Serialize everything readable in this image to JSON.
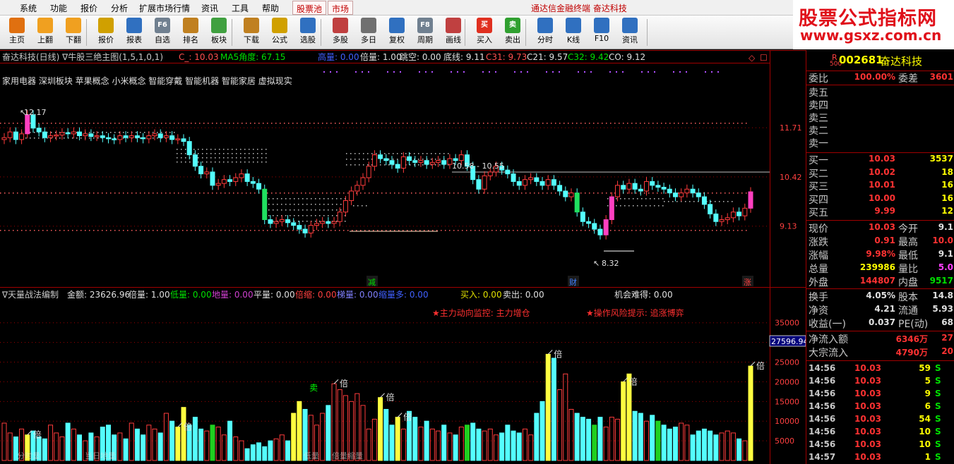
{
  "menu": {
    "items": [
      "系统",
      "功能",
      "报价",
      "分析",
      "扩展市场行情",
      "资讯",
      "工具",
      "帮助"
    ],
    "tabs": [
      "股票池",
      "市场"
    ],
    "brand": "通达信金融终端  奋达科技"
  },
  "toolbar": {
    "buttons": [
      {
        "label": "主页",
        "icon": "home-icon",
        "color": "#e07010"
      },
      {
        "label": "上翻",
        "icon": "arrow-up-icon",
        "color": "#f0a020"
      },
      {
        "label": "下翻",
        "icon": "arrow-down-icon",
        "color": "#f0a020"
      },
      {
        "label": "报价",
        "icon": "quote-icon",
        "color": "#d0a000"
      },
      {
        "label": "报表",
        "icon": "report-icon",
        "color": "#3070c0"
      },
      {
        "label": "自选",
        "icon": "f6-icon",
        "color": "#708090"
      },
      {
        "label": "排名",
        "icon": "rank-icon",
        "color": "#c08020"
      },
      {
        "label": "板块",
        "icon": "sector-icon",
        "color": "#40a040"
      },
      {
        "label": "下载",
        "icon": "download-icon",
        "color": "#c08020"
      },
      {
        "label": "公式",
        "icon": "formula-icon",
        "color": "#d0a000"
      },
      {
        "label": "选股",
        "icon": "stock-pick-icon",
        "color": "#3070c0"
      },
      {
        "label": "多股",
        "icon": "multi-stock-icon",
        "color": "#c04040"
      },
      {
        "label": "多日",
        "icon": "clock-icon",
        "color": "#707070"
      },
      {
        "label": "复权",
        "icon": "adjust-icon",
        "color": "#3070c0"
      },
      {
        "label": "周期",
        "icon": "f8-icon",
        "color": "#708090"
      },
      {
        "label": "画线",
        "icon": "draw-line-icon",
        "color": "#c04040"
      },
      {
        "label": "买入",
        "icon": "buy-icon",
        "color": "#e03020"
      },
      {
        "label": "卖出",
        "icon": "sell-icon",
        "color": "#30a030"
      },
      {
        "label": "分时",
        "icon": "intraday-icon",
        "color": "#3070c0"
      },
      {
        "label": "K线",
        "icon": "kline-icon",
        "color": "#3070c0"
      },
      {
        "label": "F10",
        "icon": "f10-icon",
        "color": "#3070c0"
      },
      {
        "label": "资讯",
        "icon": "news-icon",
        "color": "#3070c0"
      }
    ],
    "buy_glyph": "买",
    "sell_glyph": "卖",
    "f6_glyph": "F6",
    "f8_glyph": "F8"
  },
  "watermark": {
    "title": "股票公式指标网",
    "url": "www.gsxz.com.cn"
  },
  "main_chart": {
    "title": "奋达科技(日线) ∇牛股三绝主图(1,5,1,0,1)",
    "indicators": [
      {
        "text": "C_: 10.03",
        "color": "#ff5050"
      },
      {
        "text": "MA5角度: 67.15",
        "color": "#00e000"
      },
      {
        "text": "高量: 0.00",
        "color": "#4060ff"
      },
      {
        "text": "倍量: 1.00",
        "color": "#e0e0e0"
      },
      {
        "text": "跳空: 0.00",
        "color": "#e0e0e0"
      },
      {
        "text": "底线: 9.11",
        "color": "#e0e0e0"
      },
      {
        "text": "C31: 9.73",
        "color": "#ff5050"
      },
      {
        "text": "C21: 9.57",
        "color": "#e0e0e0"
      },
      {
        "text": "C32: 9.42",
        "color": "#00e000"
      },
      {
        "text": "CO: 9.12",
        "color": "#e0e0e0"
      }
    ],
    "concepts": "家用电器 深圳板块 苹果概念 小米概念 智能穿戴 智能机器 智能家居 虚拟现实",
    "high_label": "12.17",
    "low_label": "8.32",
    "range_label": "10.58 - 10.55",
    "y_ticks": [
      "11.71",
      "10.42",
      "9.13"
    ],
    "markers": [
      "减",
      "财",
      "涨"
    ]
  },
  "volume_chart": {
    "title": "∇天量战法编制",
    "indicators": [
      {
        "text": "金额: 23626.96",
        "color": "#e0e0e0"
      },
      {
        "text": "倍量: 1.00",
        "color": "#e0e0e0"
      },
      {
        "text": "低量: 0.00",
        "color": "#00e000"
      },
      {
        "text": "地量: 0.00",
        "color": "#d040d0"
      },
      {
        "text": "平量: 0.00",
        "color": "#e0e0e0"
      },
      {
        "text": "倍缩: 0.00",
        "color": "#ff4040"
      },
      {
        "text": "梯量: 0.00",
        "color": "#8080ff"
      },
      {
        "text": "缩量多: 0.00",
        "color": "#4060ff"
      },
      {
        "text": "买入: 0.00",
        "color": "#e0e000"
      },
      {
        "text": "卖出: 0.00",
        "color": "#e0e0e0"
      },
      {
        "text": "机会难得: 0.00",
        "color": "#e0e0e0"
      }
    ],
    "alert1": "★主力动向监控: 主力增仓",
    "alert2": "★操作风险提示: 追涨博弈",
    "y_ticks": [
      "35000",
      "30000",
      "25000",
      "20000",
      "15000",
      "10000",
      "5000"
    ],
    "cursor_value": "27596.94",
    "bei_label": "倍",
    "mai_label": "卖",
    "bottom_labels": [
      "分时量",
      "当日地量",
      "低量",
      "倍量缩量"
    ]
  },
  "right_panel": {
    "code": "002681",
    "name": "奋达科技",
    "r_tag": "R",
    "r_sub": "500",
    "weibi": {
      "label": "委比",
      "value": "100.00%",
      "label2": "委差",
      "value2": "3601"
    },
    "sell": [
      {
        "label": "卖五"
      },
      {
        "label": "卖四"
      },
      {
        "label": "卖三"
      },
      {
        "label": "卖二"
      },
      {
        "label": "卖一"
      }
    ],
    "buy": [
      {
        "label": "买一",
        "price": "10.03",
        "vol": "3537"
      },
      {
        "label": "买二",
        "price": "10.02",
        "vol": "18"
      },
      {
        "label": "买三",
        "price": "10.01",
        "vol": "16"
      },
      {
        "label": "买四",
        "price": "10.00",
        "vol": "16"
      },
      {
        "label": "买五",
        "price": "9.99",
        "vol": "12"
      }
    ],
    "quote": [
      {
        "l1": "现价",
        "v1": "10.03",
        "c1": "#ff3232",
        "l2": "今开",
        "v2": "9.1",
        "c2": "#e0e0e0"
      },
      {
        "l1": "涨跌",
        "v1": "0.91",
        "c1": "#ff3232",
        "l2": "最高",
        "v2": "10.0",
        "c2": "#ff3232"
      },
      {
        "l1": "涨幅",
        "v1": "9.98%",
        "c1": "#ff3232",
        "l2": "最低",
        "v2": "9.1",
        "c2": "#e0e0e0"
      },
      {
        "l1": "总量",
        "v1": "239986",
        "c1": "#ffff00",
        "l2": "量比",
        "v2": "5.0",
        "c2": "#ff40ff"
      },
      {
        "l1": "外盘",
        "v1": "144807",
        "c1": "#ff3232",
        "l2": "内盘",
        "v2": "9517",
        "c2": "#00e000"
      }
    ],
    "fund": [
      {
        "l1": "换手",
        "v1": "4.05%",
        "c1": "#e0e0e0",
        "l2": "股本",
        "v2": "14.8",
        "c2": "#e0e0e0"
      },
      {
        "l1": "净资",
        "v1": "4.21",
        "c1": "#e0e0e0",
        "l2": "流通",
        "v2": "5.93",
        "c2": "#e0e0e0"
      },
      {
        "l1": "收益(一)",
        "v1": "0.037",
        "c1": "#e0e0e0",
        "l2": "PE(动)",
        "v2": "68",
        "c2": "#e0e0e0"
      }
    ],
    "flow": [
      {
        "label": "净流入额",
        "value": "6346万",
        "value2": "27"
      },
      {
        "label": "大宗流入",
        "value": "4790万",
        "value2": "20"
      }
    ],
    "ticks": [
      {
        "time": "14:56",
        "price": "10.03",
        "vol": "59",
        "side": "S"
      },
      {
        "time": "14:56",
        "price": "10.03",
        "vol": "5",
        "side": "S"
      },
      {
        "time": "14:56",
        "price": "10.03",
        "vol": "9",
        "side": "S"
      },
      {
        "time": "14:56",
        "price": "10.03",
        "vol": "6",
        "side": "S"
      },
      {
        "time": "14:56",
        "price": "10.03",
        "vol": "54",
        "side": "S"
      },
      {
        "time": "14:56",
        "price": "10.03",
        "vol": "10",
        "side": "S"
      },
      {
        "time": "14:56",
        "price": "10.03",
        "vol": "10",
        "side": "S"
      },
      {
        "time": "14:57",
        "price": "10.03",
        "vol": "1",
        "side": "S"
      }
    ]
  },
  "chart_data": [
    {
      "type": "candlestick",
      "title": "奋达科技(日线)",
      "y_ticks": [
        11.71,
        10.42,
        9.13
      ],
      "ylim": [
        8.2,
        12.6
      ],
      "high": 12.17,
      "low": 8.32,
      "closes": [
        11.45,
        11.6,
        11.4,
        11.55,
        12.05,
        11.7,
        11.6,
        11.45,
        11.5,
        11.52,
        11.58,
        11.55,
        11.6,
        11.5,
        11.55,
        11.48,
        11.5,
        11.45,
        11.42,
        11.4,
        11.5,
        11.45,
        11.5,
        11.45,
        11.42,
        11.5,
        11.55,
        11.45,
        11.5,
        11.4,
        11.42,
        11.35,
        11.0,
        10.7,
        10.5,
        10.55,
        10.2,
        10.25,
        10.35,
        10.3,
        10.4,
        10.5,
        10.3,
        10.25,
        10.1,
        9.3,
        9.2,
        9.25,
        9.3,
        9.22,
        9.15,
        9.05,
        8.95,
        9.15,
        9.2,
        9.25,
        9.2,
        9.25,
        9.5,
        9.8,
        10.05,
        10.2,
        10.4,
        10.7,
        11.0,
        10.9,
        10.85,
        10.75,
        10.65,
        10.95,
        10.85,
        10.8,
        10.85,
        10.75,
        10.8,
        10.85,
        10.75,
        10.9,
        10.85,
        11.0,
        10.7,
        10.35,
        10.1,
        10.45,
        10.55,
        10.7,
        10.6,
        10.5,
        10.3,
        10.2,
        10.35,
        10.4,
        10.3,
        10.2,
        10.35,
        10.2,
        10.05,
        9.9,
        10.0,
        9.5,
        9.25,
        9.2,
        9.05,
        8.9,
        9.3,
        9.9,
        10.2,
        10.1,
        10.25,
        10.1,
        10.05,
        10.3,
        10.2,
        10.15,
        10.1,
        10.0,
        9.9,
        10.0,
        10.1,
        10.0,
        9.9,
        9.7,
        9.45,
        9.25,
        9.3,
        9.35,
        9.5,
        9.4,
        9.6,
        10.03
      ]
    },
    {
      "type": "bar",
      "title": "∇天量战法编制",
      "y_ticks": [
        35000,
        30000,
        25000,
        20000,
        15000,
        10000,
        5000
      ],
      "ylim": [
        0,
        38000
      ],
      "values": [
        9500,
        7000,
        6000,
        8000,
        6500,
        7500,
        6000,
        5500,
        9000,
        7000,
        6000,
        9500,
        8000,
        6500,
        5000,
        7000,
        6000,
        8500,
        9000,
        6500,
        7000,
        5500,
        9500,
        8000,
        6500,
        9000,
        8000,
        7000,
        12000,
        10000,
        8500,
        13500,
        9000,
        11000,
        8000,
        7500,
        9000,
        8500,
        6500,
        10000,
        6000,
        5000,
        3000,
        4000,
        4500,
        3500,
        5000,
        5500,
        6500,
        5000,
        12000,
        15000,
        13000,
        11500,
        9000,
        12000,
        14000,
        19500,
        18000,
        16500,
        15000,
        17000,
        14000,
        8000,
        10500,
        16000,
        13000,
        9000,
        11000,
        8000,
        12500,
        11000,
        8500,
        10000,
        8000,
        7500,
        9000,
        7000,
        6500,
        8500,
        9000,
        9500,
        8000,
        7500,
        8000,
        6500,
        7000,
        9000,
        7500,
        7000,
        8000,
        6500,
        12000,
        15000,
        27000,
        26000,
        18000,
        22000,
        13000,
        12000,
        11000,
        10500,
        9000,
        11000,
        8500,
        11000,
        10500,
        20000,
        22000,
        12500,
        12000,
        10000,
        11500,
        10000,
        9000,
        8000,
        8500,
        9500,
        9000,
        6500,
        7500,
        8000,
        7500,
        6500,
        7000,
        7500,
        7000,
        5500,
        5000,
        24000
      ]
    }
  ]
}
